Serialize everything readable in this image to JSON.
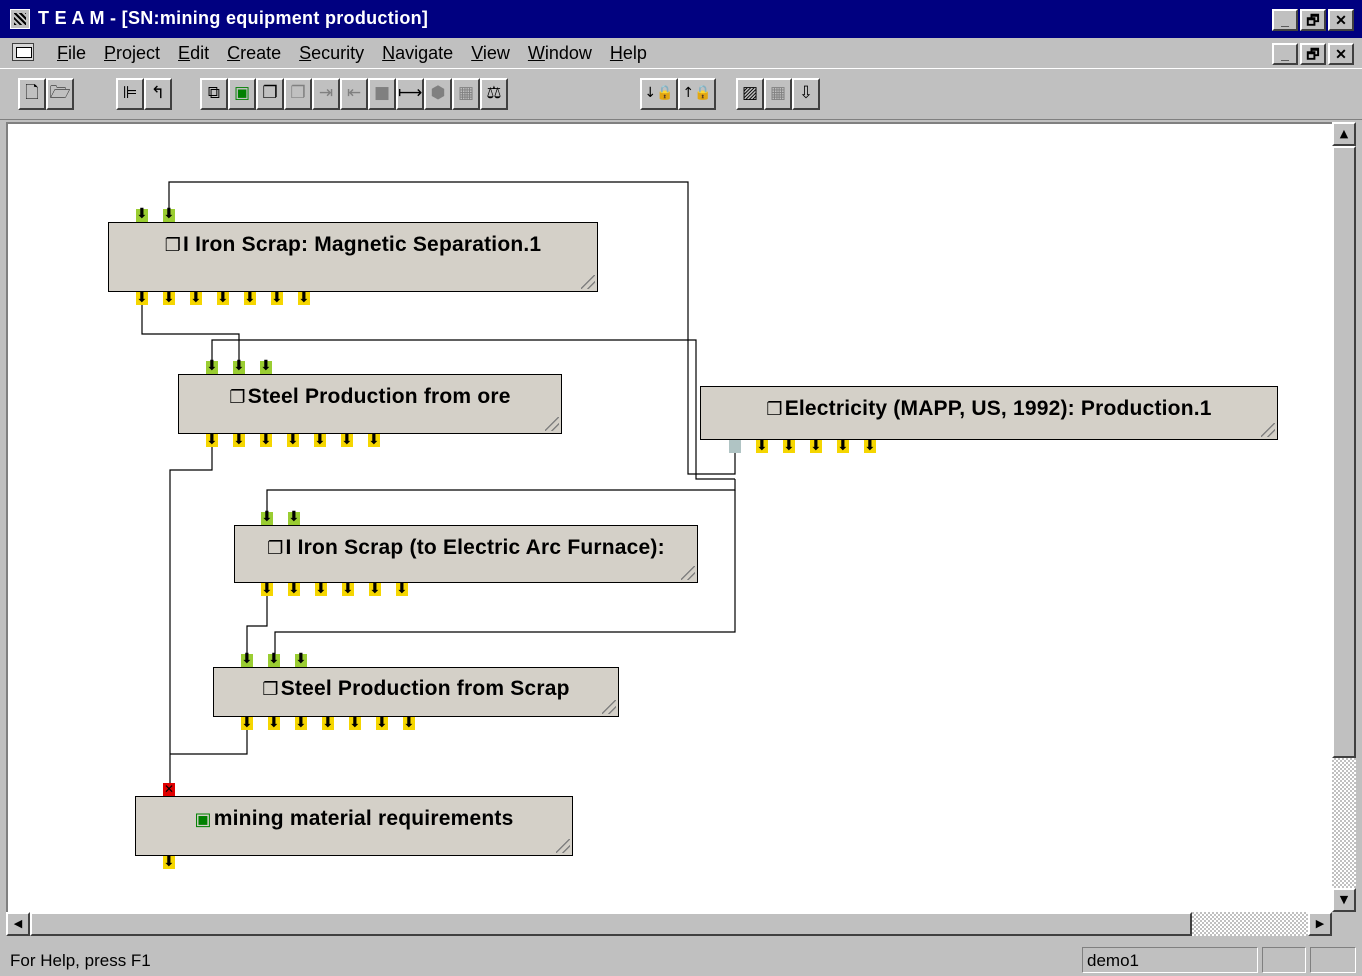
{
  "window": {
    "title": "T E A M - [SN:mining equipment production]",
    "min_glyph": "_",
    "max_glyph": "🗗",
    "close_glyph": "✕"
  },
  "menu": {
    "items": [
      {
        "key": "F",
        "rest": "ile"
      },
      {
        "key": "P",
        "rest": "roject"
      },
      {
        "key": "E",
        "rest": "dit"
      },
      {
        "key": "C",
        "rest": "reate"
      },
      {
        "key": "S",
        "rest": "ecurity"
      },
      {
        "key": "N",
        "rest": "avigate"
      },
      {
        "key": "V",
        "rest": "iew"
      },
      {
        "key": "W",
        "rest": "indow"
      },
      {
        "key": "H",
        "rest": "elp"
      }
    ]
  },
  "toolbar": {
    "buttons": [
      {
        "icon": "new-document-icon",
        "glyph": "🗋",
        "enabled": true
      },
      {
        "icon": "open-folder-icon",
        "glyph": "🗁",
        "enabled": true
      },
      {
        "icon": "tree-view-icon",
        "glyph": "⊫",
        "enabled": true
      },
      {
        "icon": "up-level-icon",
        "glyph": "↰",
        "enabled": true
      },
      {
        "icon": "import-module-icon",
        "glyph": "⧉",
        "enabled": true
      },
      {
        "icon": "add-module-icon",
        "glyph": "▣",
        "enabled": true
      },
      {
        "icon": "stack-icon",
        "glyph": "❐",
        "enabled": true
      },
      {
        "icon": "stack-disabled-icon",
        "glyph": "❐",
        "enabled": false
      },
      {
        "icon": "arrow-in-icon",
        "glyph": "⇥",
        "enabled": false
      },
      {
        "icon": "arrow-out-icon",
        "glyph": "⇤",
        "enabled": false
      },
      {
        "icon": "block-icon",
        "glyph": "■",
        "enabled": false
      },
      {
        "icon": "connect-icon",
        "glyph": "⟼",
        "enabled": true
      },
      {
        "icon": "hex-icon",
        "glyph": "⬢",
        "enabled": false
      },
      {
        "icon": "calculator-icon",
        "glyph": "▦",
        "enabled": false
      },
      {
        "icon": "balance-icon",
        "glyph": "⚖",
        "enabled": true
      },
      {
        "icon": "lock-down-icon",
        "glyph": "↓🔒",
        "enabled": true
      },
      {
        "icon": "lock-up-icon",
        "glyph": "↑🔒",
        "enabled": true
      },
      {
        "icon": "chart-icon",
        "glyph": "▨",
        "enabled": true
      },
      {
        "icon": "grid-icon",
        "glyph": "▦",
        "enabled": false
      },
      {
        "icon": "down-arrow-icon",
        "glyph": "⇩",
        "enabled": true
      }
    ]
  },
  "nodes": [
    {
      "id": "iron-scrap-magnetic",
      "icon": "module-icon",
      "label": "I Iron Scrap: Magnetic Separation.1"
    },
    {
      "id": "steel-from-ore",
      "icon": "module-icon",
      "label": "Steel Production from ore"
    },
    {
      "id": "electricity",
      "icon": "module-icon",
      "label": "Electricity (MAPP, US, 1992): Production.1"
    },
    {
      "id": "iron-scrap-eaf",
      "icon": "module-icon",
      "label": "I Iron Scrap (to Electric Arc Furnace):"
    },
    {
      "id": "steel-from-scrap",
      "icon": "module-icon",
      "label": "Steel Production from Scrap"
    },
    {
      "id": "mining-material",
      "icon": "goal-icon",
      "label": "mining material requirements"
    }
  ],
  "status": {
    "help_text": "For Help, press F1",
    "user": "demo1"
  }
}
